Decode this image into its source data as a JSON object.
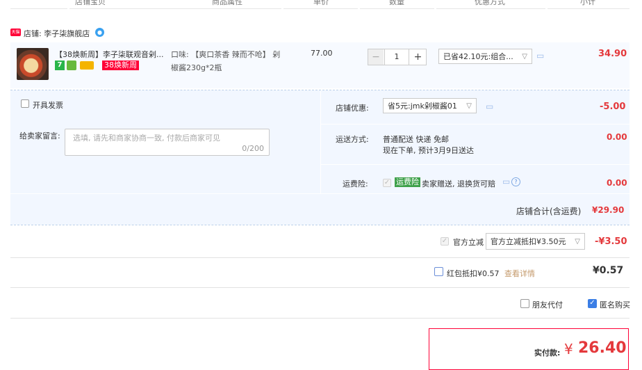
{
  "header": {
    "cols": [
      "店铺宝贝",
      "商品属性",
      "单价",
      "数量",
      "优惠方式",
      "小计"
    ]
  },
  "shop": {
    "badge": "天猫",
    "name": "店铺: 李子柒旗舰店",
    "chat_icon": "chat-bubble-icon"
  },
  "item": {
    "title": "【38焕新周】李子柒联观音剁...",
    "tag_green": "7",
    "promo_tag": "38焕新周",
    "attr_line1": "口味: 【爽口茶香 辣而不呛】 剁",
    "attr_line2": "椒酱230g*2瓶",
    "unit_price": "77.00",
    "qty": "1",
    "qty_minus": "−",
    "qty_plus": "+",
    "discount_select": "已省42.10元:组合...",
    "subtotal": "34.90"
  },
  "invoice": {
    "label": "开具发票"
  },
  "message": {
    "label": "给卖家留言:",
    "placeholder": "选填, 请先和商家协商一致, 付款后商家可见",
    "counter": "0/200"
  },
  "shop_discount": {
    "label": "店铺优惠:",
    "select": "省5元:jmk剁椒酱01",
    "amount": "-5.00"
  },
  "shipping": {
    "label": "运送方式:",
    "line1": "普通配送 快递 免邮",
    "line2": "现在下单, 预计3月9日送达",
    "amount": "0.00"
  },
  "insurance": {
    "label": "运费险:",
    "tag": "运费险",
    "text": "卖家赠送, 退换货可赔",
    "amount": "0.00"
  },
  "shop_total": {
    "label": "店铺合计(含运费)",
    "amount": "¥29.90"
  },
  "official": {
    "label": "官方立减",
    "select": "官方立减抵扣¥3.50元",
    "amount": "-¥3.50"
  },
  "redpacket": {
    "label": "红包抵扣¥0.57",
    "link": "查看详情",
    "amount": "¥0.57"
  },
  "friend_pay": {
    "label": "朋友代付"
  },
  "anonymous": {
    "label": "匿名购买"
  },
  "final": {
    "label": "实付款:",
    "currency": "¥",
    "amount": "26.40"
  },
  "colors": {
    "accent_red": "#e4393c",
    "panel_blue": "#f2f7ff",
    "checkbox_blue": "#3b7ee5"
  }
}
